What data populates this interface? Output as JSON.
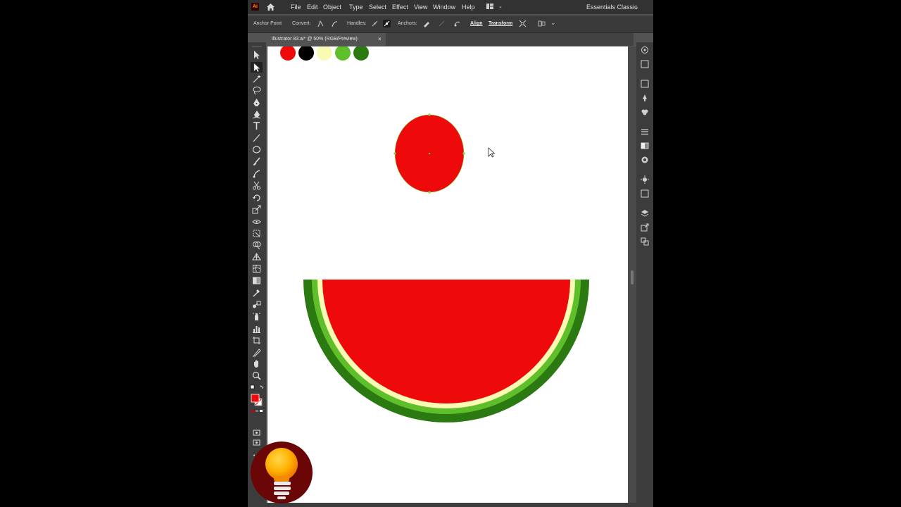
{
  "app": {
    "logo_text": "Ai",
    "menu": [
      "File",
      "Edit",
      "Object",
      "Type",
      "Select",
      "Effect",
      "View",
      "Window",
      "Help"
    ],
    "workspace": "Essentials Classic"
  },
  "control_bar": {
    "anchor_point": "Anchor Point",
    "convert": "Convert:",
    "handles": "Handles:",
    "anchors": "Anchors:",
    "align": "Align",
    "transform": "Transform"
  },
  "document": {
    "tab_title": "illustrator 83.ai* @ 50% (RGB/Preview)",
    "close": "×"
  },
  "tools": [
    "selection-tool-icon",
    "direct-selection-tool-icon",
    "magic-wand-tool-icon",
    "lasso-tool-icon",
    "pen-tool-icon",
    "curvature-tool-icon",
    "type-tool-icon",
    "line-segment-tool-icon",
    "ellipse-tool-icon",
    "paintbrush-tool-icon",
    "shaper-tool-icon",
    "scissors-tool-icon",
    "rotate-tool-icon",
    "scale-tool-icon",
    "width-tool-icon",
    "free-transform-tool-icon",
    "shape-builder-tool-icon",
    "perspective-grid-tool-icon",
    "mesh-tool-icon",
    "gradient-tool-icon",
    "eyedropper-tool-icon",
    "blend-tool-icon",
    "symbol-sprayer-tool-icon",
    "graph-tool-icon",
    "artboard-tool-icon",
    "slice-tool-icon",
    "hand-tool-icon",
    "zoom-tool-icon"
  ],
  "panels": [
    "color-panel-icon",
    "color-guide-panel-icon",
    "swatches-panel-icon",
    "brushes-panel-icon",
    "symbols-panel-icon",
    "stroke-panel-icon",
    "gradient-panel-icon",
    "transparency-panel-icon",
    "appearance-panel-icon",
    "graphic-styles-panel-icon",
    "layers-panel-icon",
    "asset-export-panel-icon",
    "artboards-panel-icon"
  ],
  "swatches": [
    "#ee0a0a",
    "#000000",
    "#f9fbb4",
    "#5fbf2b",
    "#2a7a11"
  ],
  "artwork": {
    "fill_color": "#ee0a0a",
    "stroke_color": "none",
    "selection_color": "#7ed34a",
    "red_flesh": "#ee0a0a",
    "cream_rind": "#f9fbb4",
    "light_rind": "#5fbf2b",
    "dark_rind": "#2a7a11"
  }
}
